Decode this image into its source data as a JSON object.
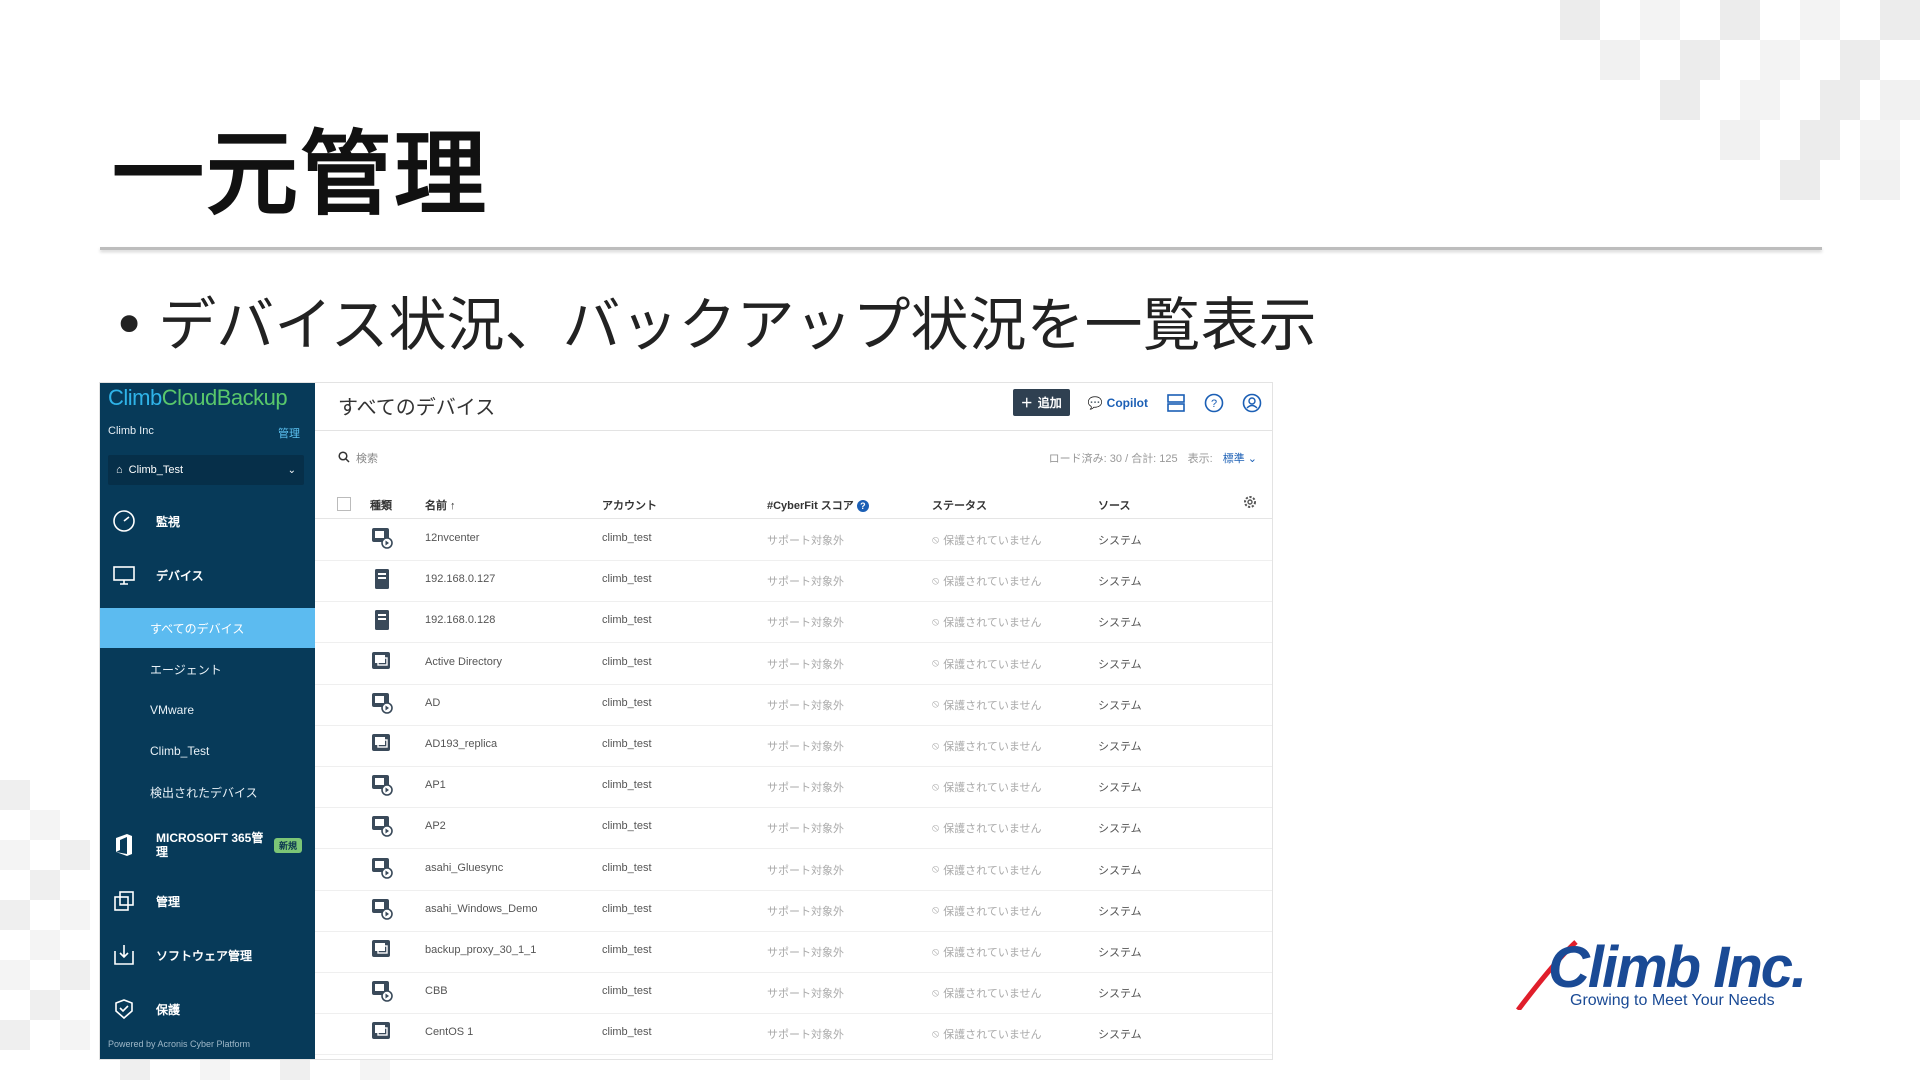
{
  "slide": {
    "title": "一元管理",
    "bullet": "デバイス状況、バックアップ状況を一覧表示"
  },
  "app": {
    "logo_climb": "Climb",
    "logo_cloud": "CloudBackup",
    "org_name": "Climb Inc",
    "org_manage": "管理",
    "tenant": "Climb_Test",
    "powered_by": "Powered by Acronis Cyber Platform",
    "nav": {
      "monitor": "監視",
      "devices": "デバイス",
      "microsoft365": "MICROSOFT 365管理",
      "microsoft365_badge": "新規",
      "management": "管理",
      "software": "ソフトウェア管理",
      "protection": "保護"
    },
    "sub_nav": [
      {
        "label": "すべてのデバイス"
      },
      {
        "label": "エージェント"
      },
      {
        "label": "VMware"
      },
      {
        "label": "Climb_Test"
      },
      {
        "label": "検出されたデバイス"
      }
    ]
  },
  "main": {
    "page_title": "すべてのデバイス",
    "add_button": "追加",
    "copilot": "Copilot",
    "search_placeholder": "検索",
    "load_info": "ロード済み: 30 / 合計: 125",
    "view_label": "表示:",
    "view_value": "標準",
    "columns": {
      "type": "種類",
      "name": "名前 ↑",
      "account": "アカウント",
      "cyberfit": "#CyberFit スコア",
      "status": "ステータス",
      "source": "ソース"
    },
    "rows": [
      {
        "name": "12nvcenter",
        "account": "climb_test",
        "cyberfit": "サポート対象外",
        "status": "保護されていません",
        "source": "システム",
        "icon": "vm-icon"
      },
      {
        "name": "192.168.0.127",
        "account": "climb_test",
        "cyberfit": "サポート対象外",
        "status": "保護されていません",
        "source": "システム",
        "icon": "server-icon"
      },
      {
        "name": "192.168.0.128",
        "account": "climb_test",
        "cyberfit": "サポート対象外",
        "status": "保護されていません",
        "source": "システム",
        "icon": "server-icon"
      },
      {
        "name": "Active Directory",
        "account": "climb_test",
        "cyberfit": "サポート対象外",
        "status": "保護されていません",
        "source": "システム",
        "icon": "vm-machine-icon"
      },
      {
        "name": "AD",
        "account": "climb_test",
        "cyberfit": "サポート対象外",
        "status": "保護されていません",
        "source": "システム",
        "icon": "vm-icon"
      },
      {
        "name": "AD193_replica",
        "account": "climb_test",
        "cyberfit": "サポート対象外",
        "status": "保護されていません",
        "source": "システム",
        "icon": "vm-machine-icon"
      },
      {
        "name": "AP1",
        "account": "climb_test",
        "cyberfit": "サポート対象外",
        "status": "保護されていません",
        "source": "システム",
        "icon": "vm-icon"
      },
      {
        "name": "AP2",
        "account": "climb_test",
        "cyberfit": "サポート対象外",
        "status": "保護されていません",
        "source": "システム",
        "icon": "vm-icon"
      },
      {
        "name": "asahi_Gluesync",
        "account": "climb_test",
        "cyberfit": "サポート対象外",
        "status": "保護されていません",
        "source": "システム",
        "icon": "vm-icon"
      },
      {
        "name": "asahi_Windows_Demo",
        "account": "climb_test",
        "cyberfit": "サポート対象外",
        "status": "保護されていません",
        "source": "システム",
        "icon": "vm-icon"
      },
      {
        "name": "backup_proxy_30_1_1",
        "account": "climb_test",
        "cyberfit": "サポート対象外",
        "status": "保護されていません",
        "source": "システム",
        "icon": "vm-machine-icon"
      },
      {
        "name": "CBB",
        "account": "climb_test",
        "cyberfit": "サポート対象外",
        "status": "保護されていません",
        "source": "システム",
        "icon": "vm-icon"
      },
      {
        "name": "CentOS 1",
        "account": "climb_test",
        "cyberfit": "サポート対象外",
        "status": "保護されていません",
        "source": "システム",
        "icon": "vm-machine-icon"
      }
    ]
  },
  "brand": {
    "company": "Climb Inc.",
    "tagline": "Growing to Meet Your Needs",
    "colors": {
      "navy": "#073a59",
      "active": "#5cbbf0",
      "brand_blue": "#1a4a95",
      "brand_red": "#e01e2b"
    }
  }
}
